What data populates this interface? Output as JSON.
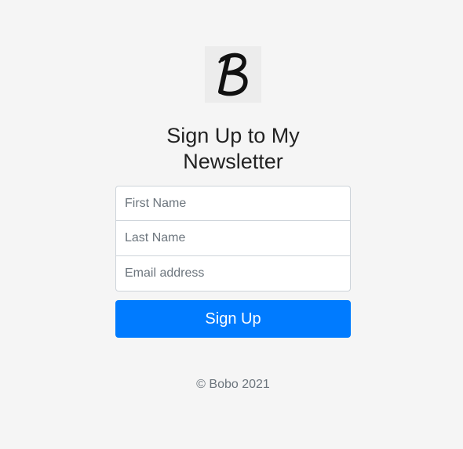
{
  "logo": {
    "letter": "B",
    "icon": "brush-letter-b-logo"
  },
  "heading": {
    "line1": "Sign Up to My",
    "line2": "Newsletter"
  },
  "form": {
    "first_name_placeholder": "First Name",
    "last_name_placeholder": "Last Name",
    "email_placeholder": "Email address",
    "submit_label": "Sign Up"
  },
  "footer": {
    "copyright": "© Bobo 2021"
  },
  "colors": {
    "background": "#f5f5f5",
    "primary": "#007bff",
    "text": "#222222",
    "muted": "#6c757d"
  }
}
